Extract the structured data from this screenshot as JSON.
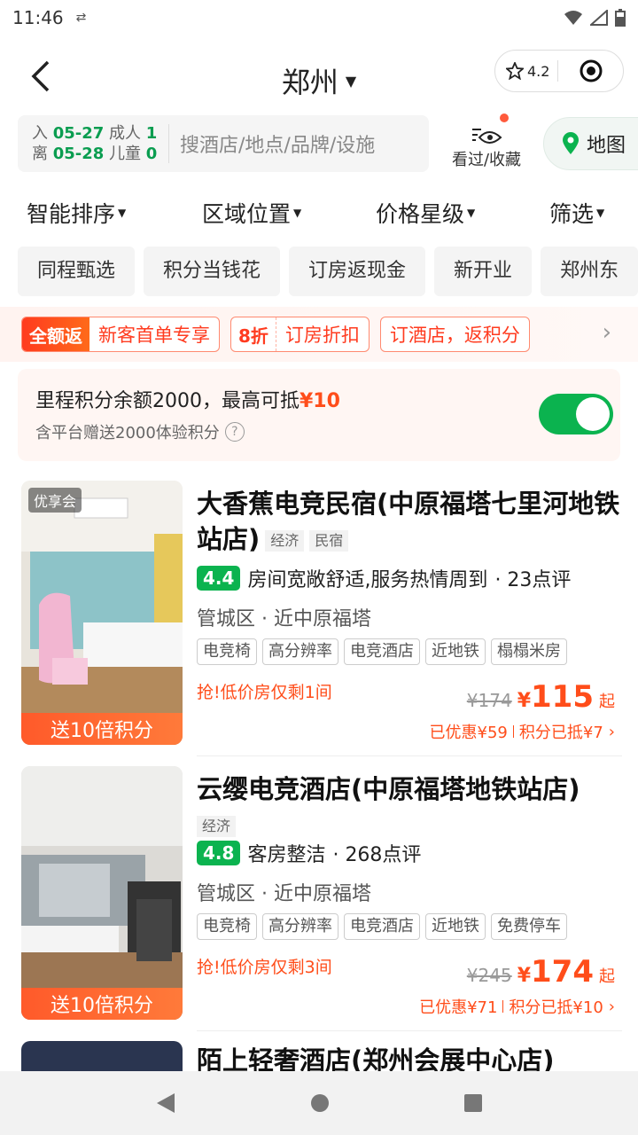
{
  "status": {
    "time": "11:46",
    "extra": "⇄"
  },
  "header": {
    "city": "郑州",
    "rating": "4.2"
  },
  "search": {
    "checkin_label": "入",
    "checkin": "05-27",
    "checkout_label": "离",
    "checkout": "05-28",
    "adults_label": "成人",
    "adults": "1",
    "children_label": "儿童",
    "children": "0",
    "placeholder": "搜酒店/地点/品牌/设施",
    "history_label": "看过/收藏",
    "map_label": "地图"
  },
  "sort": [
    "智能排序",
    "区域位置",
    "价格星级",
    "筛选"
  ],
  "chips": [
    "同程甄选",
    "积分当钱花",
    "订房返现金",
    "新开业",
    "郑州东"
  ],
  "promos": [
    {
      "lead": "全额返",
      "text": "新客首单专享",
      "style": "solid"
    },
    {
      "lead": "8折",
      "text": "订房折扣",
      "style": "plain"
    },
    {
      "lead": "",
      "text": "订酒店，返积分",
      "style": "none"
    }
  ],
  "points": {
    "main": "里程积分余额2000，最高可抵",
    "amount": "¥10",
    "sub": "含平台赠送2000体验积分",
    "toggle_on": true
  },
  "hotels": [
    {
      "badge": "优享会",
      "img_bottom": "送10倍积分",
      "name": "大香蕉电竞民宿(中原福塔七里河地铁站店)",
      "tags": [
        "经济",
        "民宿"
      ],
      "score": "4.4",
      "review": "房间宽敞舒适,服务热情周到",
      "review_count": "· 23点评",
      "location": "管城区 · 近中原福塔",
      "features": [
        "电竞椅",
        "高分辨率",
        "电竞酒店",
        "近地铁",
        "榻榻米房"
      ],
      "urgent": "抢!低价房仅剩1间",
      "old_price": "¥174",
      "price": "115",
      "qi": "起",
      "saved": "已优惠¥59",
      "points_used": "积分已抵¥7"
    },
    {
      "badge": "",
      "img_bottom": "送10倍积分",
      "name": "云缨电竞酒店(中原福塔地铁站店)",
      "tags": [
        "经济"
      ],
      "score": "4.8",
      "review": "客房整洁",
      "review_count": "· 268点评",
      "location": "管城区 · 近中原福塔",
      "features": [
        "电竞椅",
        "高分辨率",
        "电竞酒店",
        "近地铁",
        "免费停车"
      ],
      "urgent": "抢!低价房仅剩3间",
      "old_price": "¥245",
      "price": "174",
      "qi": "起",
      "saved": "已优惠¥71",
      "points_used": "积分已抵¥10"
    },
    {
      "name": "陌上轻奢酒店(郑州会展中心店)"
    }
  ],
  "colors": {
    "accent_green": "#0bb34f",
    "price_orange": "#ff4d1a"
  }
}
